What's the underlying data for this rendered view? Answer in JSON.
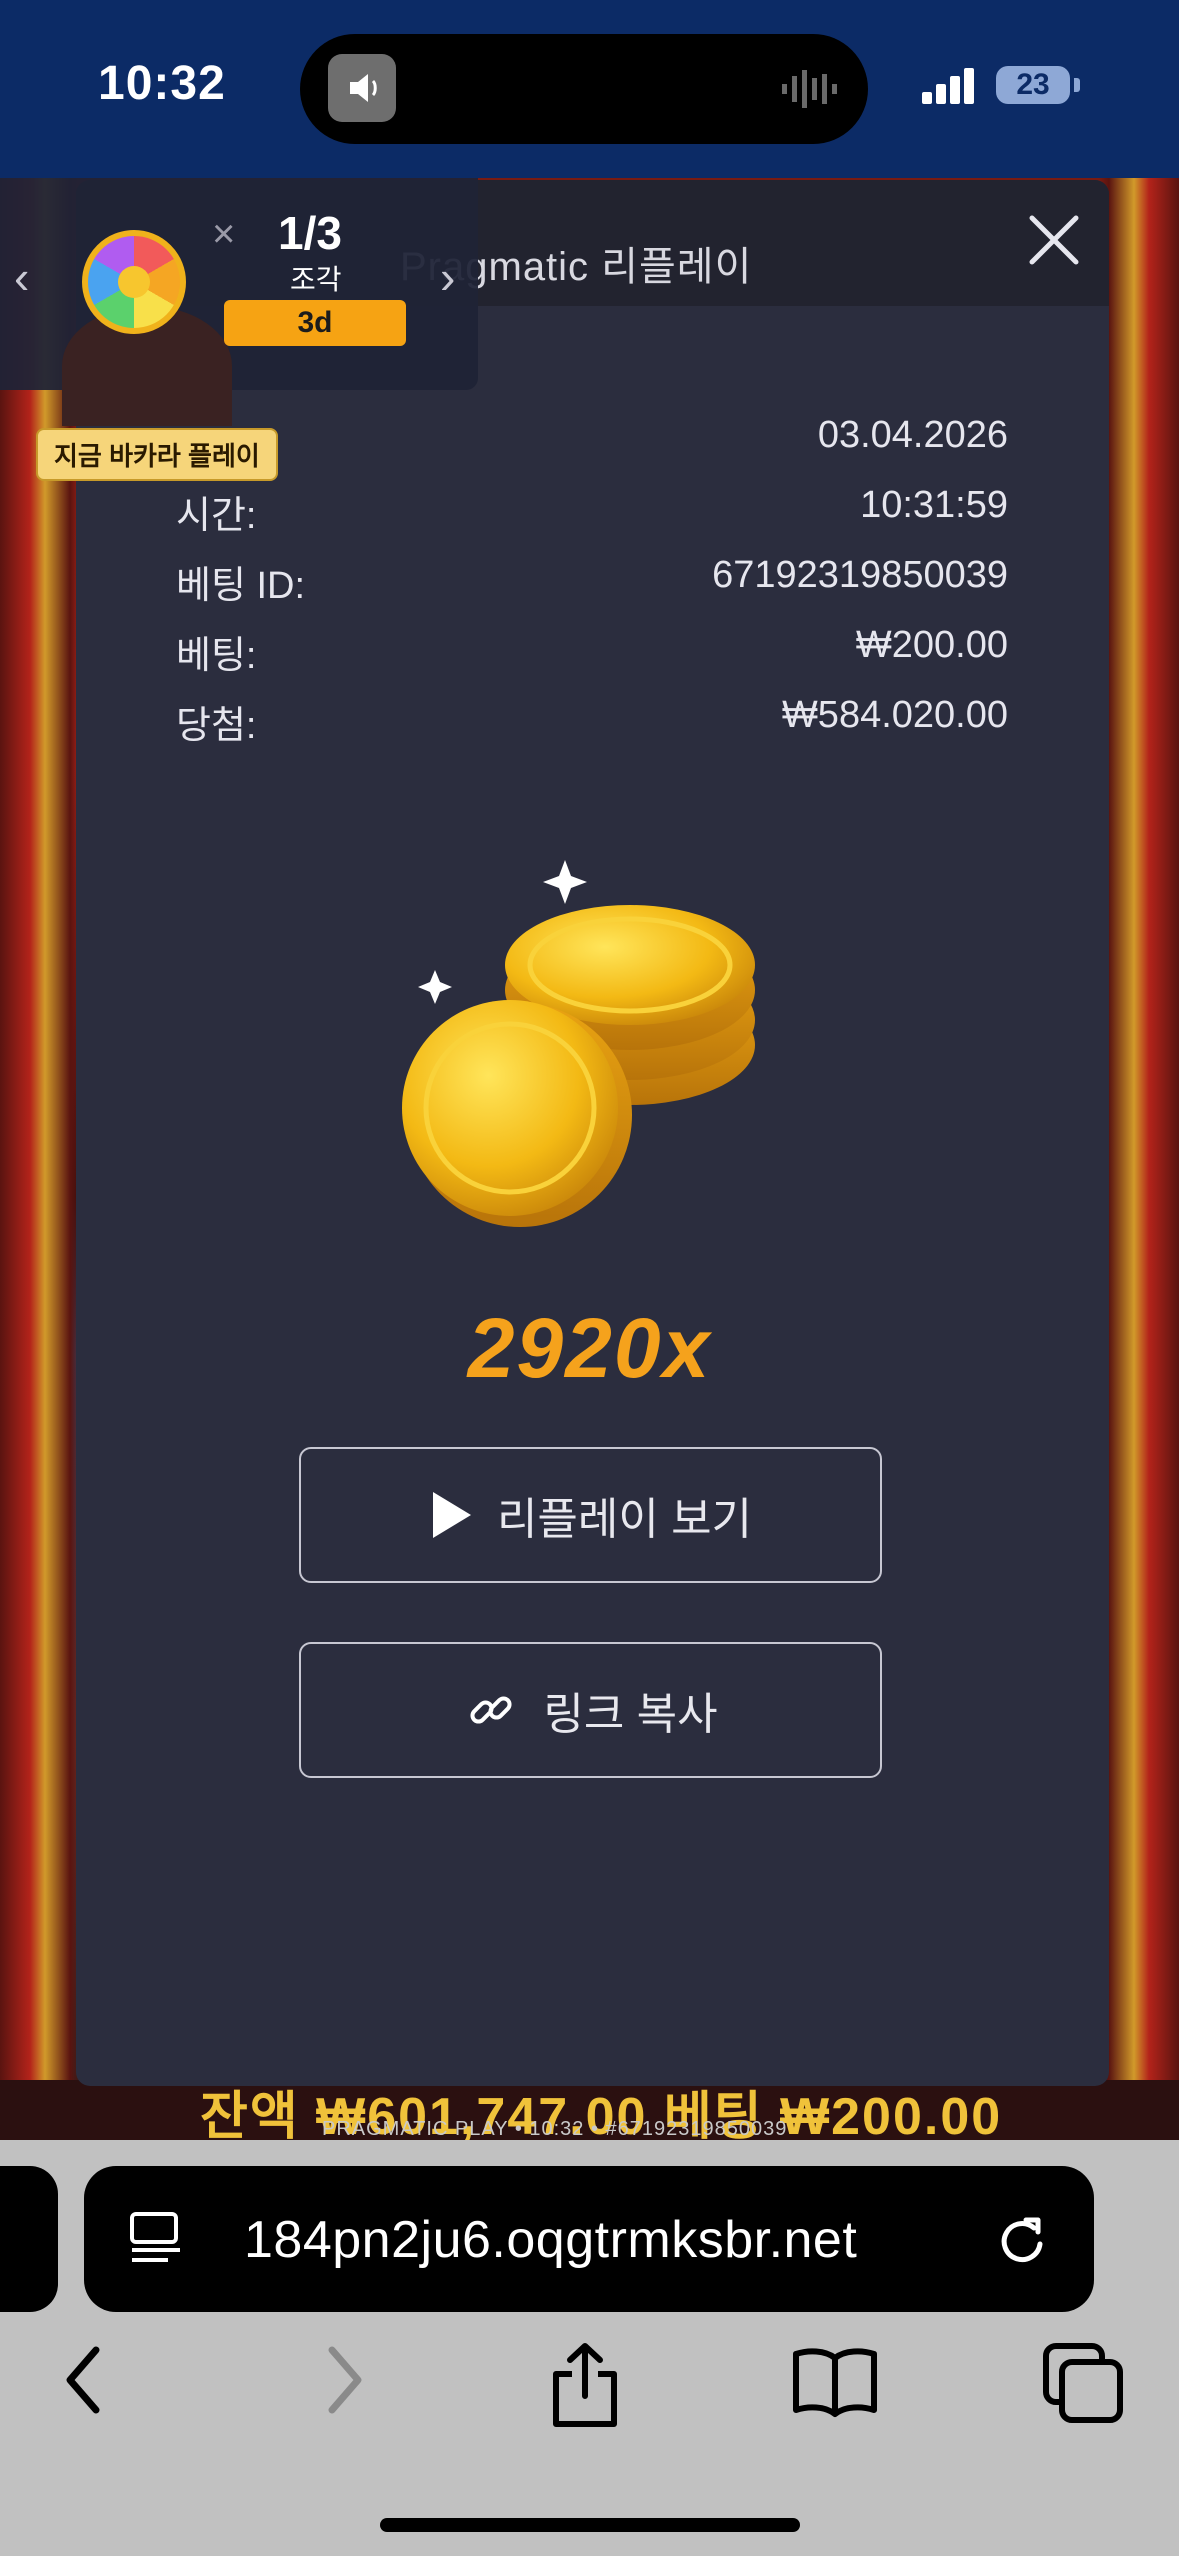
{
  "status_bar": {
    "time": "10:32",
    "battery": "23"
  },
  "promo": {
    "count": "1/3",
    "sub": "조각",
    "pill": "3d",
    "badge": "지금 바카라 플레이"
  },
  "panel": {
    "title": "Pragmatic 리플레이",
    "rows": [
      {
        "label": "",
        "value": "03.04.2026"
      },
      {
        "label": "시간:",
        "value": "10:31:59"
      },
      {
        "label": "베팅 ID:",
        "value": "67192319850039"
      },
      {
        "label": "베팅:",
        "value": "₩200.00"
      },
      {
        "label": "당첨:",
        "value": "₩584.020.00"
      }
    ],
    "multiplier": "2920x",
    "replay_label": "리플레이 보기",
    "copy_label": "링크 복사"
  },
  "game": {
    "ticker": "잔액 ₩601,747.00 베팅 ₩200.00",
    "meta": "PRAGMATIC PLAY • 10:32 • #67192319850039"
  },
  "browser": {
    "url": "184pn2ju6.oqgtrmksbr.net"
  }
}
